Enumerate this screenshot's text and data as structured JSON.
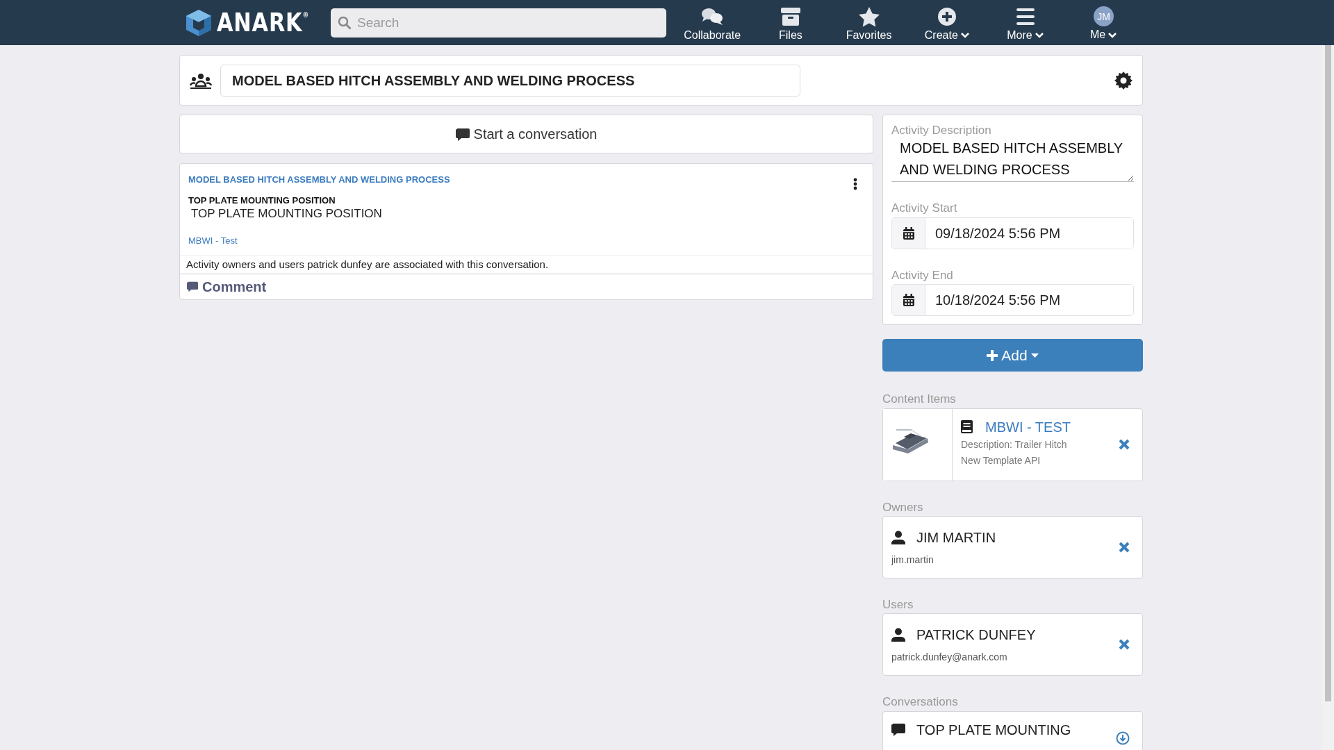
{
  "navbar": {
    "logo": "ANARK$^{®}$",
    "search": {
      "placeholder": "Search"
    },
    "items": [
      {
        "label": "Collaborate",
        "dropdown": false
      },
      {
        "label": "Files",
        "dropdown": false
      },
      {
        "label": "Favorites",
        "dropdown": false
      },
      {
        "label": "Create",
        "dropdown": true
      },
      {
        "label": "More",
        "dropdown": true
      },
      {
        "label": "Me",
        "dropdown": true,
        "avatar": "JM"
      }
    ]
  },
  "activity": {
    "title": "MODEL BASED HITCH ASSEMBLY AND WELDING PROCESS"
  },
  "start_conversation": "Start a conversation",
  "conversation": {
    "activity": "MODEL BASED HITCH ASSEMBLY AND WELDING PROCESS",
    "title": "TOP PLATE MOUNTING POSITION",
    "body": "TOP PLATE MOUNTING POSITION",
    "content_link": "MBWI - Test",
    "notice": "Activity owners and users patrick dunfey are associated with this conversation.",
    "comment": "Comment"
  },
  "details": {
    "description_label": "Activity Description",
    "description": "MODEL BASED HITCH ASSEMBLY AND WELDING PROCESS",
    "start_label": "Activity Start",
    "start": "09/18/2024 5:56 PM",
    "end_label": "Activity End",
    "end": "10/18/2024 5:56 PM"
  },
  "add_button": "Add",
  "sections": [
    {
      "heading": "Content Items",
      "kind": "content",
      "items": [
        {
          "title": "MBWI - TEST",
          "lines": [
            "Description: Trailer Hitch",
            "New Template API"
          ]
        }
      ]
    },
    {
      "heading": "Owners",
      "kind": "person",
      "items": [
        {
          "title": "JIM MARTIN",
          "detail": "jim.martin"
        }
      ]
    },
    {
      "heading": "Users",
      "kind": "person",
      "items": [
        {
          "title": "PATRICK DUNFEY",
          "detail": "patrick.dunfey@anark.com"
        }
      ]
    },
    {
      "heading": "Conversations",
      "kind": "conversation",
      "items": [
        {
          "title": "TOP PLATE MOUNTING"
        }
      ]
    }
  ]
}
